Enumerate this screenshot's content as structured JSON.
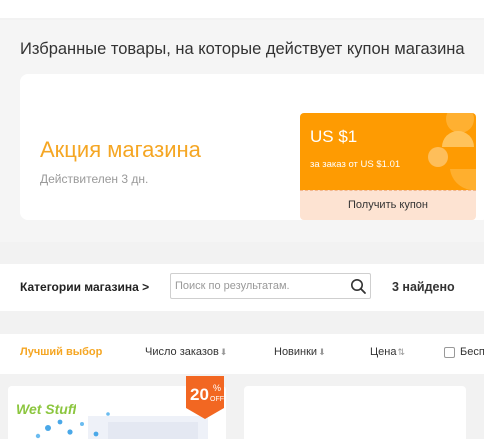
{
  "coupon_section": {
    "title": "Избранные товары, на которые действует купон магазина",
    "promo": {
      "title": "Акция магазина",
      "validity": "Действителен 3 дн."
    },
    "coupon": {
      "amount": "US $1",
      "condition": "за заказ от US $1.01",
      "action_label": "Получить купон",
      "color": "#fe9b02"
    }
  },
  "category_bar": {
    "label": "Категории магазина >",
    "search": {
      "value": "",
      "placeholder": "Поиск по результатам."
    },
    "found": "3 найдено"
  },
  "sort_bar": {
    "items": [
      {
        "label": "Лучший выбор",
        "active": true
      },
      {
        "label": "Число заказов",
        "arrow": "⬇"
      },
      {
        "label": "Новинки",
        "arrow": "⬇"
      },
      {
        "label": "Цена",
        "arrow": "⇅"
      }
    ],
    "free_shipping_label": "Бесплатная доставка",
    "accent_color": "#f5a623"
  },
  "products": {
    "first": {
      "badge_value": "20",
      "badge_percent": "%",
      "badge_off": "OFF",
      "brand": "Wet Stuff",
      "badge_color": "#f26722"
    }
  }
}
